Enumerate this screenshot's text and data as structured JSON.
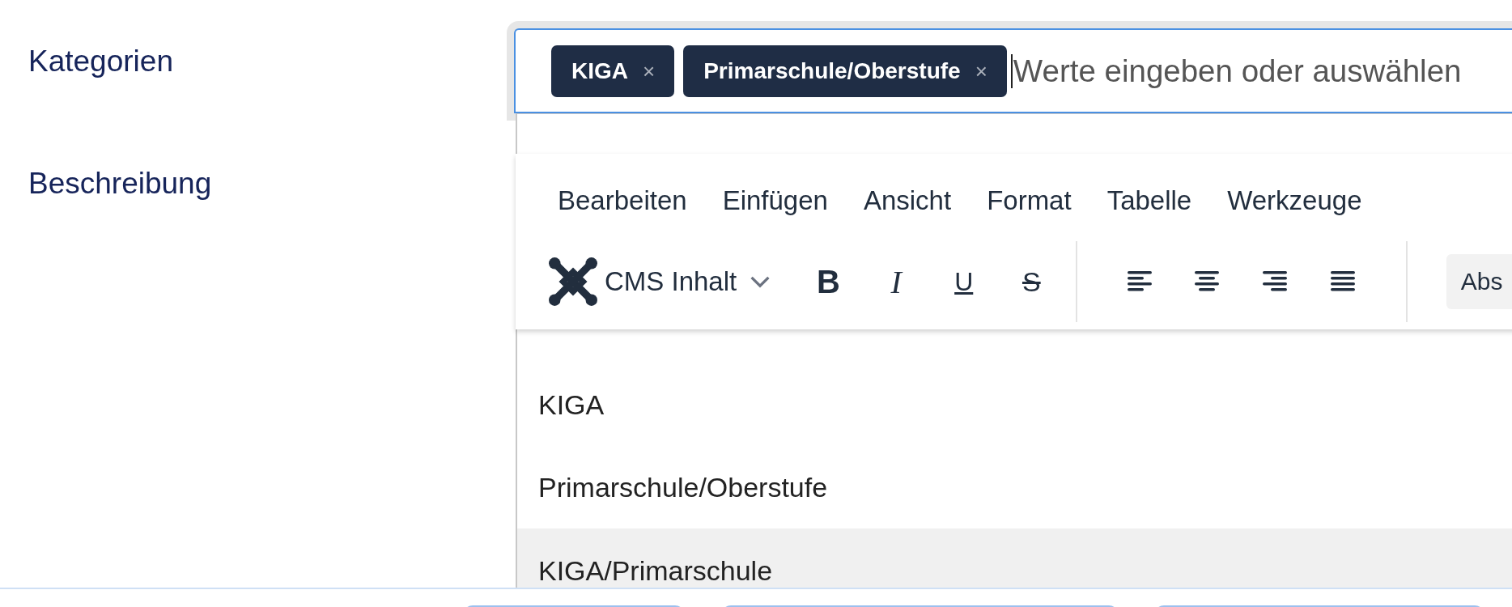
{
  "categories": {
    "label": "Kategorien",
    "tags": [
      {
        "label": "KIGA",
        "remove": "×"
      },
      {
        "label": "Primarschule/Oberstufe",
        "remove": "×"
      }
    ],
    "placeholder": "Werte eingeben oder auswählen",
    "options": [
      {
        "label": "KIGA",
        "highlighted": false
      },
      {
        "label": "Primarschule/Oberstufe",
        "highlighted": false
      },
      {
        "label": "KIGA/Primarschule",
        "highlighted": true
      }
    ]
  },
  "description": {
    "label": "Beschreibung",
    "editor": {
      "menu": [
        "Bearbeiten",
        "Einfügen",
        "Ansicht",
        "Format",
        "Tabelle",
        "Werkzeuge"
      ],
      "content_menu": "CMS Inhalt",
      "format_buttons": [
        {
          "kind": "bold",
          "glyph": "B"
        },
        {
          "kind": "italic",
          "glyph": "I"
        },
        {
          "kind": "underline",
          "glyph": "U"
        },
        {
          "kind": "strike",
          "glyph": "S"
        }
      ],
      "align_buttons": [
        {
          "kind": "left"
        },
        {
          "kind": "center"
        },
        {
          "kind": "right"
        },
        {
          "kind": "justify"
        }
      ],
      "block_format": "Abs"
    }
  }
}
